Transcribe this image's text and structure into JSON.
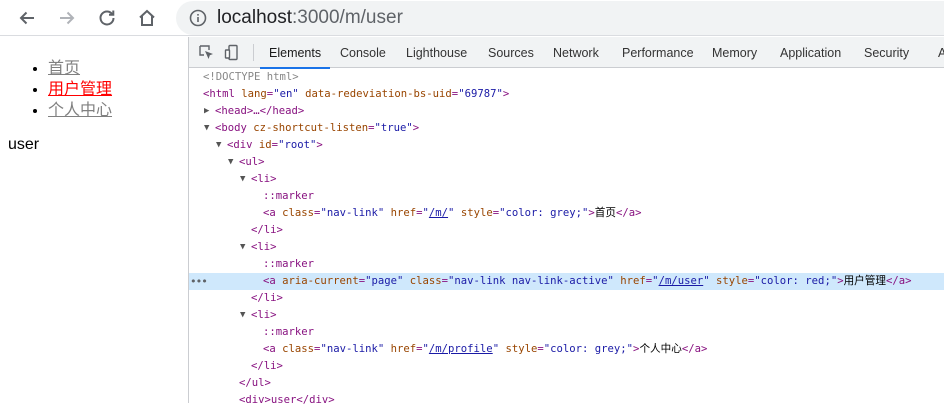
{
  "browser": {
    "url_host": "localhost",
    "url_path": ":3000/m/user"
  },
  "page": {
    "nav": [
      {
        "label": "首页",
        "color": "#808080"
      },
      {
        "label": "用户管理",
        "color": "#ff0000"
      },
      {
        "label": "个人中心",
        "color": "#808080"
      }
    ],
    "content": "user"
  },
  "devtools": {
    "tabs": [
      "Elements",
      "Console",
      "Lighthouse",
      "Sources",
      "Network",
      "Performance",
      "Memory",
      "Application",
      "Security",
      "A"
    ],
    "active_tab": "Elements",
    "dom": {
      "doctype": "<!DOCTYPE html>",
      "html_open": "<html",
      "html_attr_lang": "lang",
      "html_val_lang": "\"en\"",
      "html_attr_uid": "data-redeviation-bs-uid",
      "html_val_uid": "\"69787\"",
      "head": "<head>…</head>",
      "body_open": "<body",
      "body_attr": "cz-shortcut-listen",
      "body_val": "\"true\"",
      "div_open": "<div",
      "div_attr": "id",
      "div_val": "\"root\"",
      "ul_open": "<ul>",
      "li_open": "<li>",
      "li_close": "</li>",
      "marker": "::marker",
      "a_open": "<a",
      "attr_class": "class",
      "attr_href": "href",
      "attr_style": "style",
      "attr_aria": "aria-current",
      "val_aria": "\"page\"",
      "val_class_link": "\"nav-link\"",
      "val_class_active": "\"nav-link nav-link-active\"",
      "href_home": "/m/",
      "href_user": "/m/user",
      "href_profile": "/m/profile",
      "style_grey": "\"color: grey;\"",
      "style_red": "\"color: red;\"",
      "a_close": "</a>",
      "ul_close": "</ul>",
      "last_line": "<div>user</div>"
    }
  }
}
